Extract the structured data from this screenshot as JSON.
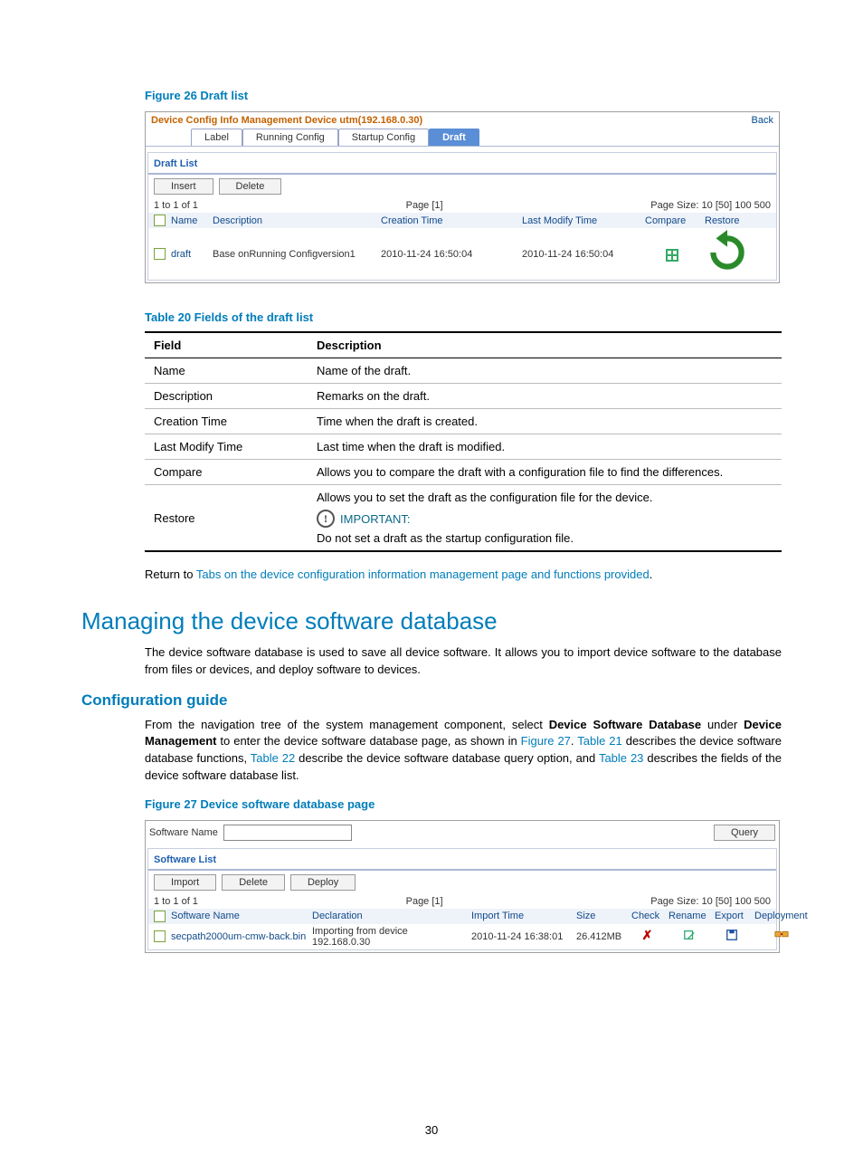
{
  "figure26": {
    "caption": "Figure 26 Draft list",
    "crumb": "Device Config Info Management Device utm(192.168.0.30)",
    "back": "Back",
    "tabs": [
      "Label",
      "Running Config",
      "Startup Config",
      "Draft"
    ],
    "panel": "Draft List",
    "buttons": {
      "insert": "Insert",
      "delete": "Delete"
    },
    "pager": {
      "range": "1 to 1 of 1",
      "mid": "Page [1]",
      "right_prefix": "Page Size: ",
      "sizes": "10 [50] 100 500"
    },
    "columns": [
      "Name",
      "Description",
      "Creation Time",
      "Last Modify Time",
      "Compare",
      "Restore"
    ],
    "row": {
      "name": "draft",
      "desc": "Base onRunning Configversion1",
      "ctime": "2010-11-24 16:50:04",
      "mtime": "2010-11-24 16:50:04"
    }
  },
  "table20": {
    "caption": "Table 20 Fields of the draft list",
    "head": {
      "field": "Field",
      "desc": "Description"
    },
    "rows": [
      {
        "field": "Name",
        "desc": "Name of the draft."
      },
      {
        "field": "Description",
        "desc": "Remarks on the draft."
      },
      {
        "field": "Creation Time",
        "desc": "Time when the draft is created."
      },
      {
        "field": "Last Modify Time",
        "desc": "Last time when the draft is modified."
      },
      {
        "field": "Compare",
        "desc": "Allows you to compare the draft with a configuration file to find the differences."
      }
    ],
    "restore": {
      "field": "Restore",
      "line1": "Allows you to set the draft as the configuration file for the device.",
      "important": "IMPORTANT:",
      "line2": "Do not set a draft as the startup configuration file."
    }
  },
  "return_line": {
    "prefix": "Return to ",
    "link": "Tabs on the device configuration information management page and functions provided",
    "suffix": "."
  },
  "h1": "Managing the device software database",
  "intro": "The device software database is used to save all device software. It allows you to import device software to the database from files or devices, and deploy software to devices.",
  "h2": "Configuration guide",
  "guide": {
    "p1a": "From the navigation tree of the system management component, select ",
    "bold1": "Device Software Database",
    "p1b": " under ",
    "bold2": "Device Management",
    "p1c": " to enter the device software database page, as shown in ",
    "link_fig27": "Figure 27",
    "p1d": ". ",
    "link_t21": "Table 21",
    "p1e": " describes the device software database functions, ",
    "link_t22": "Table 22",
    "p1f": " describe the device software database query option, and ",
    "link_t23": "Table 23",
    "p1g": " describes the fields of the device software database list."
  },
  "figure27": {
    "caption": "Figure 27 Device software database page",
    "query_label": "Software Name",
    "query_btn": "Query",
    "panel": "Software List",
    "buttons": {
      "import": "Import",
      "delete": "Delete",
      "deploy": "Deploy"
    },
    "pager": {
      "range": "1 to 1 of 1",
      "mid": "Page [1]",
      "right_prefix": "Page Size: ",
      "sizes": "10 [50] 100 500"
    },
    "columns": [
      "Software Name",
      "Declaration",
      "Import Time",
      "Size",
      "Check",
      "Rename",
      "Export",
      "Deployment"
    ],
    "row": {
      "name": "secpath2000um-cmw-back.bin",
      "decl": "Importing from device 192.168.0.30",
      "itime": "2010-11-24 16:38:01",
      "size": "26.412MB"
    }
  },
  "page_number": "30"
}
